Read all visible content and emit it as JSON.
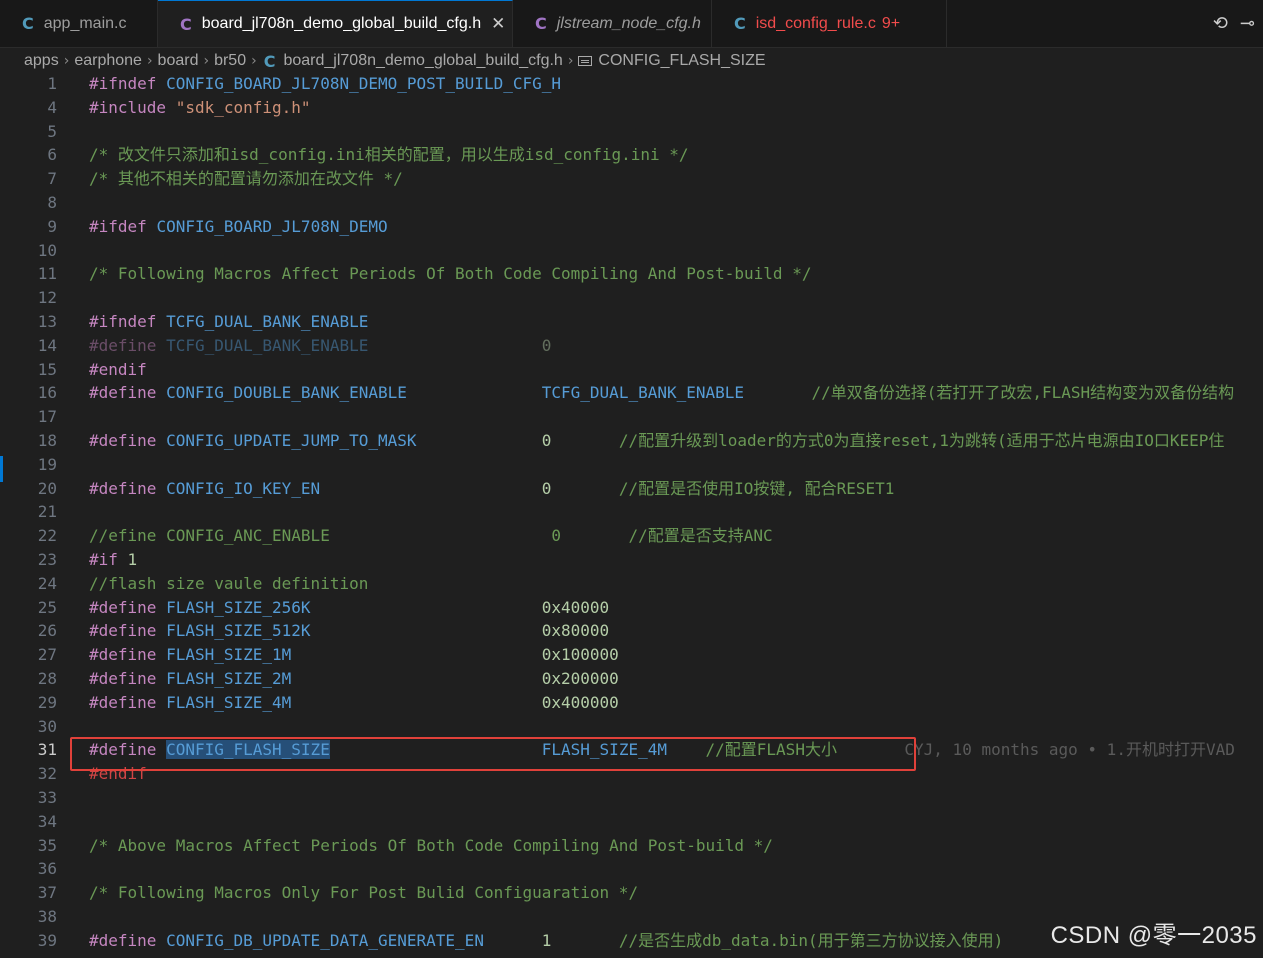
{
  "tabs": [
    {
      "label": "app_main.c",
      "icon": "C",
      "icon_color": "#519aba",
      "italic": false,
      "active": false,
      "modified": false,
      "badge": "",
      "label_color": ""
    },
    {
      "label": "board_jl708n_demo_global_build_cfg.h",
      "icon": "C",
      "icon_color": "#a074c4",
      "italic": false,
      "active": true,
      "close": "✕",
      "badge": "",
      "label_color": ""
    },
    {
      "label": "jlstream_node_cfg.h",
      "icon": "C",
      "icon_color": "#a074c4",
      "italic": true,
      "active": false,
      "badge": "",
      "label_color": ""
    },
    {
      "label": "isd_config_rule.c",
      "icon": "C",
      "icon_color": "#519aba",
      "italic": false,
      "active": false,
      "badge": "9+",
      "label_color": "#f14c4c"
    }
  ],
  "tab_actions": {
    "icon_a": "⟲",
    "icon_b": "⊸"
  },
  "breadcrumb": {
    "items": [
      "apps",
      "earphone",
      "board",
      "br50"
    ],
    "file": "board_jl708n_demo_global_build_cfg.h",
    "symbol": "CONFIG_FLASH_SIZE"
  },
  "editor": {
    "lines": [
      {
        "n": "1",
        "parts": [
          [
            "kw",
            "#ifndef "
          ],
          [
            "mac",
            "CONFIG_BOARD_JL708N_DEMO_POST_BUILD_CFG_H"
          ]
        ]
      },
      {
        "n": "4",
        "parts": [
          [
            "kw",
            "#include "
          ],
          [
            "str",
            "\"sdk_config.h\""
          ]
        ]
      },
      {
        "n": "5",
        "parts": []
      },
      {
        "n": "6",
        "parts": [
          [
            "cm",
            "/* 改文件只添加和isd_config.ini相关的配置，用以生成isd_config.ini */"
          ]
        ]
      },
      {
        "n": "7",
        "parts": [
          [
            "cm",
            "/* 其他不相关的配置请勿添加在改文件 */"
          ]
        ]
      },
      {
        "n": "8",
        "parts": []
      },
      {
        "n": "9",
        "parts": [
          [
            "kw",
            "#ifdef "
          ],
          [
            "mac",
            "CONFIG_BOARD_JL708N_DEMO"
          ]
        ]
      },
      {
        "n": "10",
        "parts": []
      },
      {
        "n": "11",
        "parts": [
          [
            "cm",
            "/* Following Macros Affect Periods Of Both Code Compiling And Post-build */"
          ]
        ]
      },
      {
        "n": "12",
        "parts": []
      },
      {
        "n": "13",
        "parts": [
          [
            "kw",
            "#ifndef "
          ],
          [
            "mac",
            "TCFG_DUAL_BANK_ENABLE"
          ]
        ]
      },
      {
        "n": "14",
        "parts": [
          [
            "kw dim",
            "#define "
          ],
          [
            "mac dim",
            "TCFG_DUAL_BANK_ENABLE                  "
          ],
          [
            "num dim",
            "0"
          ]
        ]
      },
      {
        "n": "15",
        "parts": [
          [
            "kw",
            "#endif"
          ]
        ]
      },
      {
        "n": "16",
        "parts": [
          [
            "kw",
            "#define "
          ],
          [
            "mac",
            "CONFIG_DOUBLE_BANK_ENABLE              "
          ],
          [
            "val",
            "TCFG_DUAL_BANK_ENABLE       "
          ],
          [
            "cm",
            "//单双备份选择(若打开了改宏,FLASH结构变为双备份结构"
          ]
        ]
      },
      {
        "n": "17",
        "parts": []
      },
      {
        "n": "18",
        "parts": [
          [
            "kw",
            "#define "
          ],
          [
            "mac",
            "CONFIG_UPDATE_JUMP_TO_MASK             "
          ],
          [
            "num",
            "0       "
          ],
          [
            "cm",
            "//配置升级到loader的方式0为直接reset,1为跳转(适用于芯片电源由IO口KEEP住"
          ]
        ]
      },
      {
        "n": "19",
        "parts": []
      },
      {
        "n": "20",
        "parts": [
          [
            "kw",
            "#define "
          ],
          [
            "mac",
            "CONFIG_IO_KEY_EN                       "
          ],
          [
            "num",
            "0       "
          ],
          [
            "cm",
            "//配置是否使用IO按键, 配合RESET1"
          ]
        ]
      },
      {
        "n": "21",
        "parts": []
      },
      {
        "n": "22",
        "parts": [
          [
            "cm",
            "//efine CONFIG_ANC_ENABLE                       0       //配置是否支持ANC"
          ]
        ]
      },
      {
        "n": "23",
        "parts": [
          [
            "kw",
            "#if "
          ],
          [
            "num",
            "1"
          ]
        ]
      },
      {
        "n": "24",
        "parts": [
          [
            "cm",
            "//flash size vaule definition"
          ]
        ]
      },
      {
        "n": "25",
        "parts": [
          [
            "kw",
            "#define "
          ],
          [
            "mac",
            "FLASH_SIZE_256K                        "
          ],
          [
            "num",
            "0x40000"
          ]
        ]
      },
      {
        "n": "26",
        "parts": [
          [
            "kw",
            "#define "
          ],
          [
            "mac",
            "FLASH_SIZE_512K                        "
          ],
          [
            "num",
            "0x80000"
          ]
        ]
      },
      {
        "n": "27",
        "parts": [
          [
            "kw",
            "#define "
          ],
          [
            "mac",
            "FLASH_SIZE_1M                          "
          ],
          [
            "num",
            "0x100000"
          ]
        ]
      },
      {
        "n": "28",
        "parts": [
          [
            "kw",
            "#define "
          ],
          [
            "mac",
            "FLASH_SIZE_2M                          "
          ],
          [
            "num",
            "0x200000"
          ]
        ]
      },
      {
        "n": "29",
        "parts": [
          [
            "kw",
            "#define "
          ],
          [
            "mac",
            "FLASH_SIZE_4M                          "
          ],
          [
            "num",
            "0x400000"
          ]
        ]
      },
      {
        "n": "30",
        "parts": []
      },
      {
        "n": "31",
        "current": true,
        "parts": [
          [
            "kw",
            "#define "
          ],
          [
            "mac sel",
            "CONFIG_FLASH_SIZE"
          ],
          [
            "mac",
            "                      "
          ],
          [
            "val",
            "FLASH_SIZE_4M    "
          ],
          [
            "cm",
            "//配置FLASH大小       "
          ],
          [
            "blame",
            "CYJ, 10 months ago • 1.开机时打开VAD "
          ]
        ]
      },
      {
        "n": "32",
        "parts": [
          [
            "err",
            "#endif"
          ]
        ]
      },
      {
        "n": "33",
        "parts": []
      },
      {
        "n": "34",
        "parts": []
      },
      {
        "n": "35",
        "parts": [
          [
            "cm",
            "/* Above Macros Affect Periods Of Both Code Compiling And Post-build */"
          ]
        ]
      },
      {
        "n": "36",
        "parts": []
      },
      {
        "n": "37",
        "parts": [
          [
            "cm",
            "/* Following Macros Only For Post Bulid Configuaration */"
          ]
        ]
      },
      {
        "n": "38",
        "parts": []
      },
      {
        "n": "39",
        "parts": [
          [
            "kw",
            "#define "
          ],
          [
            "mac",
            "CONFIG_DB_UPDATE_DATA_GENERATE_EN      "
          ],
          [
            "num",
            "1       "
          ],
          [
            "cm",
            "//是否生成db_data.bin(用于第三方协议接入使用)"
          ]
        ]
      }
    ]
  },
  "watermark": "CSDN @零一2035"
}
